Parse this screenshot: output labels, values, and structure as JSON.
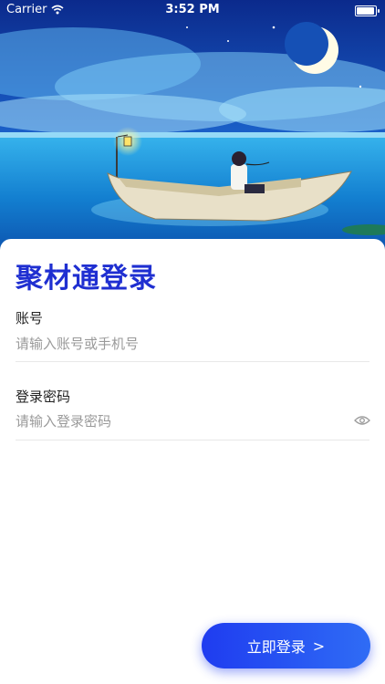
{
  "status_bar": {
    "carrier": "Carrier",
    "time": "3:52 PM"
  },
  "login": {
    "title": "聚材通登录",
    "account_label": "账号",
    "account_placeholder": "请输入账号或手机号",
    "password_label": "登录密码",
    "password_placeholder": "请输入登录密码",
    "submit_label": "立即登录",
    "submit_chevron": ">"
  },
  "colors": {
    "accent": "#1f2fd1",
    "button_start": "#1f3cf0",
    "button_end": "#2f6cf5"
  },
  "icons": [
    "wifi-icon",
    "battery-icon",
    "eye-icon",
    "chevron-right-icon"
  ]
}
